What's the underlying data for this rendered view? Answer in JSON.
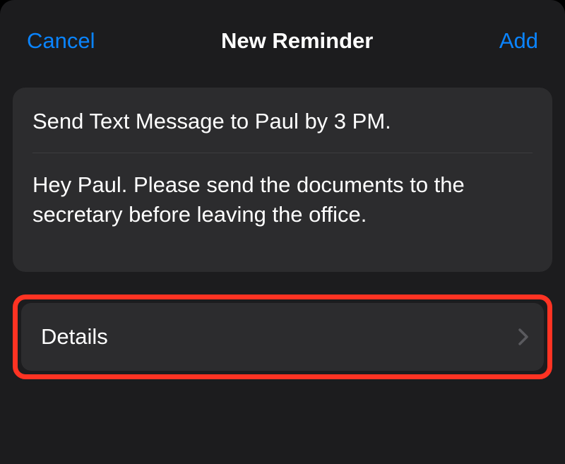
{
  "nav": {
    "cancel": "Cancel",
    "title": "New Reminder",
    "add": "Add"
  },
  "reminder": {
    "title": "Send Text Message to Paul by 3 PM.",
    "notes": "Hey Paul. Please send the documents to the secretary before leaving the office."
  },
  "details": {
    "label": "Details"
  }
}
